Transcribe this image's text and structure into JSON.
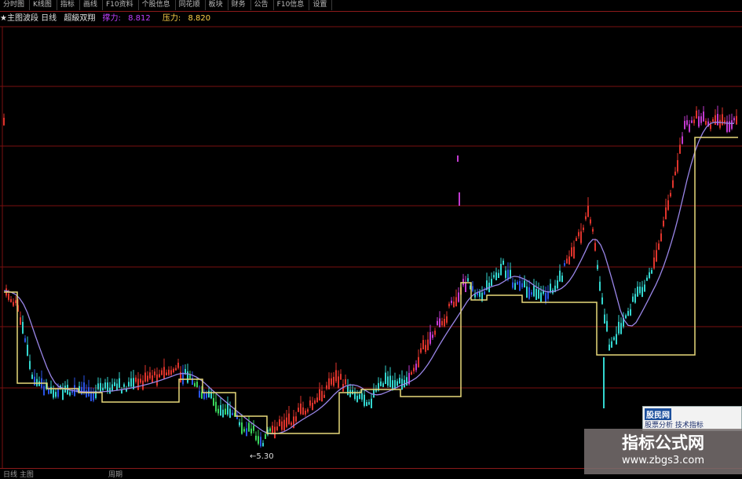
{
  "menu": {
    "items": [
      "分时图",
      "K线图",
      "指标",
      "画线",
      "F10资料",
      "个股信息",
      "同花顺",
      "板块",
      "财务",
      "公告",
      "F10信息",
      "设置"
    ]
  },
  "titlebar": {
    "name": "★主图波段 日线",
    "indicator": "超級双翔",
    "support_label": "撑力:",
    "support_value": "8.812",
    "resistance_label": "压力:",
    "resistance_value": "8.820"
  },
  "chart": {
    "low_label": "←5.30",
    "colors": {
      "grid": "#7a0f0f",
      "ma": "#9a86e8",
      "step": "#e8d97a",
      "red": "#e0342c",
      "magenta": "#c23ad0",
      "cyan": "#33d6cf",
      "blue": "#2a55e8",
      "yellow": "#e8c33a",
      "green": "#3ad65a"
    }
  },
  "bottombar": {
    "left": "日线 主图",
    "mid": "周期"
  },
  "watermark": {
    "badge_top": "股民网",
    "badge_bottom": "股票分析 技术指标",
    "title": "指标公式网",
    "url": "www.zbgs3.com"
  }
}
